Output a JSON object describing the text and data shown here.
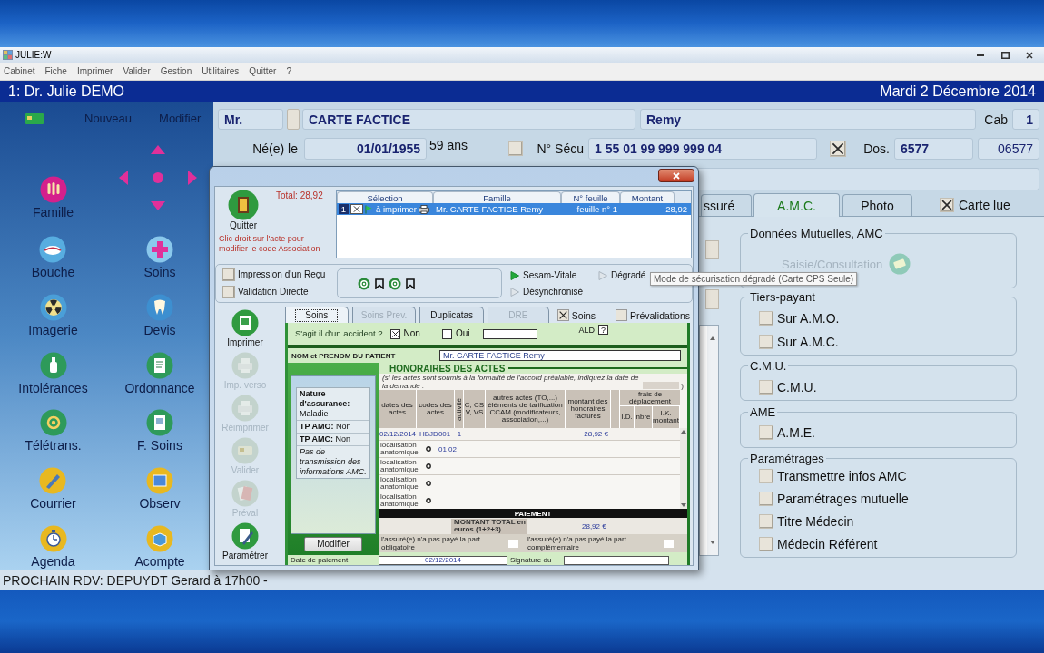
{
  "window": {
    "title": "JULIE:W"
  },
  "menu": [
    "Cabinet",
    "Fiche",
    "Imprimer",
    "Valider",
    "Gestion",
    "Utilitaires",
    "Quitter",
    "?"
  ],
  "header": {
    "doctor": "1: Dr. Julie DEMO",
    "date": "Mardi 2 Décembre 2014"
  },
  "sidebar": {
    "actions": [
      "Nouveau",
      "Modifier"
    ],
    "items": [
      "Famille",
      "Bouche",
      "Soins",
      "Imagerie",
      "Devis",
      "Intolérances",
      "Ordonnance",
      "Télétrans.",
      "F. Soins",
      "Courrier",
      "Observ",
      "Agenda",
      "Acompte"
    ]
  },
  "patient": {
    "civility": "Mr.",
    "last_name": "CARTE FACTICE",
    "first_name": "Remy",
    "cab_label": "Cab",
    "cab": "1",
    "birth_label": "Né(e) le",
    "birth_date": "01/01/1955",
    "age": "59 ans",
    "flag_checked": false,
    "secu_label": "N° Sécu",
    "secu": "1 55 01 99 999 999 04",
    "secu_checked": true,
    "dos_label": "Dos.",
    "dos": "6577",
    "dos_code": "06577"
  },
  "tabs": [
    {
      "label": "ssuré",
      "selected": false
    },
    {
      "label": "A.M.C.",
      "selected": true
    },
    {
      "label": "Photo",
      "selected": false
    }
  ],
  "card_read": {
    "label": "Carte lue",
    "checked": true
  },
  "dialog": {
    "quit": "Quitter",
    "total": "Total: 28,92",
    "hint": "Clic droit sur l'acte pour modifier le code Association",
    "list": {
      "columns": [
        "Sélection",
        "Famille",
        "N° feuille",
        "Montant"
      ],
      "rows": [
        {
          "number": "1",
          "checked": true,
          "status": "à imprimer",
          "patient": "Mr. CARTE FACTICE Remy",
          "sheet": "feuille n° 1",
          "amount": "28,92",
          "selected": true
        }
      ]
    },
    "options": [
      {
        "label": "Impression d'un Reçu",
        "checked": false
      },
      {
        "label": "Validation Directe",
        "checked": false
      }
    ],
    "modes": [
      {
        "label": "Sesam-Vitale",
        "active": true
      },
      {
        "label": "Dégradé",
        "active": false
      },
      {
        "label": "Désynchronisé",
        "active": false
      }
    ],
    "side_buttons": [
      {
        "label": "Imprimer",
        "disabled": false
      },
      {
        "label": "Imp. verso",
        "disabled": true
      },
      {
        "label": "Réimprimer",
        "disabled": true
      },
      {
        "label": "Valider",
        "disabled": true
      },
      {
        "label": "Préval",
        "disabled": true
      },
      {
        "label": "Paramétrer",
        "disabled": false
      }
    ],
    "tabs": [
      {
        "label": "Soins",
        "selected": true,
        "disabled": false
      },
      {
        "label": "Soins Prev.",
        "selected": false,
        "disabled": true
      },
      {
        "label": "Duplicatas",
        "selected": false,
        "disabled": false
      },
      {
        "label": "DRE",
        "selected": false,
        "disabled": true
      }
    ],
    "tab_checks": [
      {
        "label": "Soins",
        "checked": true
      },
      {
        "label": "Prévalidations",
        "checked": false
      }
    ],
    "form": {
      "accident_question": "S'agit il d'un accident ?",
      "accident_options": [
        {
          "label": "Non",
          "checked": true
        },
        {
          "label": "Oui",
          "checked": false
        }
      ],
      "ald_label": "ALD",
      "ald_value": "?",
      "patient_label": "NOM et PRENOM DU PATIENT",
      "patient_name": "Mr. CARTE FACTICE Remy",
      "section_title": "HONORAIRES DES ACTES",
      "section_note": "(si les actes sont soumis à la formalité de l'accord préalable, indiquez la date de la demande :",
      "section_note_end": ")",
      "insurance": [
        "**Nature d'assurance:** Maladie",
        "**TP AMO:** Non",
        "**TP AMC:** Non"
      ],
      "insurance_note": "Pas de transmission des informations AMC.",
      "modify": "Modifier",
      "columns": [
        "dates des actes",
        "codes des actes",
        "activité",
        "C, CS V, VS",
        "autres actes (TO,...) éléments de tarification CCAM (modificateurs, association,...)",
        "montant des honoraires facturés"
      ],
      "travel": {
        "title": "frais de déplacement",
        "columns": [
          "I.D.",
          "nbre",
          "I.K. montant"
        ]
      },
      "acts": [
        {
          "date": "02/12/2014",
          "code": "HBJD001",
          "activity": "1",
          "amount": "28,92 €"
        }
      ],
      "localisations": [
        {
          "label": "localisation anatomique",
          "value": "01 02"
        },
        {
          "label": "localisation anatomique"
        },
        {
          "label": "localisation anatomique"
        },
        {
          "label": "localisation anatomique"
        }
      ],
      "payment_title": "PAIEMENT",
      "total_label": "MONTANT TOTAL en euros (1+2+3)",
      "total": "28,92 €",
      "unpaid": [
        {
          "label": "l'assuré(e) n'a pas payé la part obligatoire",
          "checked": false
        },
        {
          "label": "l'assuré(e) n'a pas payé la part complémentaire",
          "checked": false
        }
      ],
      "payment_date_label": "Date de paiement",
      "payment_date": "02/12/2014",
      "signature_label": "Signature du"
    }
  },
  "tooltip": "Mode de sécurisation dégradé (Carte CPS Seule)",
  "amc_groups": [
    {
      "title": "Données Mutuelles, AMC",
      "kind": "button",
      "button": {
        "label": "Saisie/Consultation",
        "disabled": true
      }
    },
    {
      "title": "Tiers-payant",
      "kind": "checks",
      "options": [
        {
          "label": "Sur A.M.O.",
          "checked": false
        },
        {
          "label": "Sur A.M.C.",
          "checked": false
        }
      ]
    },
    {
      "title": "C.M.U.",
      "kind": "checks",
      "options": [
        {
          "label": "C.M.U.",
          "checked": false
        }
      ]
    },
    {
      "title": "AME",
      "kind": "checks",
      "options": [
        {
          "label": "A.M.E.",
          "checked": false
        }
      ]
    },
    {
      "title": "Paramétrages",
      "kind": "checks",
      "options": [
        {
          "label": "Transmettre infos AMC",
          "checked": false
        },
        {
          "label": "Paramétrages mutuelle",
          "checked": false
        },
        {
          "label": "Titre Médecin",
          "checked": false
        },
        {
          "label": "Médecin Référent",
          "checked": false
        }
      ]
    }
  ],
  "status_bar": "PROCHAIN RDV: DEPUYDT Gerard à 17h00 -"
}
